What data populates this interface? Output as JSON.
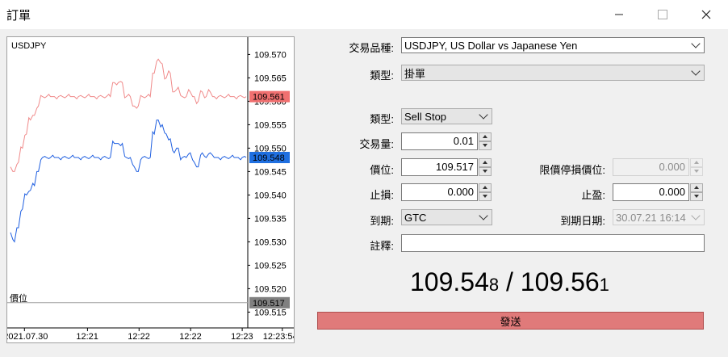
{
  "window": {
    "title": "訂單",
    "minimize_icon": "minimize-icon",
    "maximize_icon": "maximize-icon",
    "close_icon": "close-icon"
  },
  "chart": {
    "symbol": "USDJPY",
    "price_line_label": "價位",
    "ask_marker": "109.561",
    "bid_marker": "109.548",
    "price_marker": "109.517",
    "ask_color": "#f08a8a",
    "bid_color": "#1f5fe0",
    "ask_marker_color": "#f07070",
    "bid_marker_color": "#1f6fe0",
    "price_marker_color": "#808080",
    "y_ticks": [
      "109.570",
      "109.565",
      "109.560",
      "109.555",
      "109.550",
      "109.545",
      "109.540",
      "109.535",
      "109.530",
      "109.525",
      "109.520",
      "109.515"
    ],
    "x_ticks": [
      "2021.07.30",
      "12:21",
      "12:22",
      "12:22",
      "12:23",
      "12:23:54"
    ]
  },
  "chart_data": {
    "type": "line",
    "x": [
      0,
      1,
      2,
      3,
      4,
      5,
      6,
      7,
      8,
      9,
      10,
      11,
      12,
      13,
      14,
      15,
      16,
      17,
      18,
      19,
      20,
      21,
      22,
      23,
      24,
      25,
      26,
      27,
      28,
      29,
      30,
      31,
      32,
      33,
      34,
      35,
      36,
      37,
      38,
      39,
      40,
      41,
      42,
      43,
      44,
      45,
      46,
      47,
      48,
      49,
      50,
      51,
      52,
      53,
      54,
      55,
      56,
      57,
      58,
      59
    ],
    "series": [
      {
        "values": [
          109.546,
          109.545,
          109.547,
          109.55,
          109.553,
          109.556,
          109.557,
          109.559,
          109.561,
          109.561,
          109.561,
          109.561,
          109.561,
          109.561,
          109.561,
          109.561,
          109.561,
          109.561,
          109.561,
          109.561,
          109.561,
          109.561,
          109.561,
          109.561,
          109.561,
          109.561,
          109.564,
          109.564,
          109.564,
          109.561,
          109.561,
          109.559,
          109.559,
          109.561,
          109.561,
          109.561,
          109.566,
          109.569,
          109.568,
          109.565,
          109.566,
          109.562,
          109.563,
          109.561,
          109.561,
          109.562,
          109.561,
          109.56,
          109.562,
          109.561,
          109.562,
          109.561,
          109.561,
          109.561,
          109.561,
          109.561,
          109.561,
          109.561,
          109.561,
          109.561
        ]
      },
      {
        "values": [
          109.532,
          109.53,
          109.533,
          109.537,
          109.54,
          109.541,
          109.542,
          109.545,
          109.548,
          109.548,
          109.548,
          109.548,
          109.548,
          109.548,
          109.548,
          109.548,
          109.548,
          109.548,
          109.548,
          109.548,
          109.548,
          109.548,
          109.548,
          109.548,
          109.548,
          109.548,
          109.551,
          109.551,
          109.551,
          109.548,
          109.548,
          109.546,
          109.545,
          109.548,
          109.548,
          109.548,
          109.553,
          109.556,
          109.555,
          109.553,
          109.552,
          109.549,
          109.55,
          109.548,
          109.548,
          109.549,
          109.547,
          109.546,
          109.549,
          109.548,
          109.549,
          109.548,
          109.548,
          109.548,
          109.548,
          109.548,
          109.548,
          109.548,
          109.548,
          109.548
        ]
      }
    ],
    "ylim": [
      109.513,
      109.573
    ],
    "horizontal_line": 109.517,
    "grid": false
  },
  "form": {
    "symbol_label": "交易品種:",
    "symbol_value": "USDJPY, US Dollar vs Japanese Yen",
    "type_label": "類型:",
    "type_value": "掛單",
    "order_type_label": "類型:",
    "order_type_value": "Sell Stop",
    "volume_label": "交易量:",
    "volume_value": "0.01",
    "price_label": "價位:",
    "price_value": "109.517",
    "stop_limit_label": "限價停損價位:",
    "stop_limit_value": "0.000",
    "sl_label": "止損:",
    "sl_value": "0.000",
    "tp_label": "止盈:",
    "tp_value": "0.000",
    "expiry_label": "到期:",
    "expiry_value": "GTC",
    "expiry_date_label": "到期日期:",
    "expiry_date_value": "30.07.21 16:14",
    "comment_label": "註釋:",
    "comment_value": ""
  },
  "quote": {
    "bid_main": "109.54",
    "bid_small": "8",
    "sep": " / ",
    "ask_main": "109.56",
    "ask_small": "1"
  },
  "send_label": "發送",
  "send_color": "#e07a7a"
}
